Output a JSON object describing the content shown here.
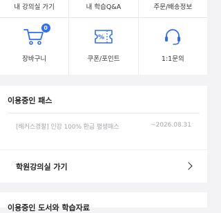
{
  "top_menu": [
    {
      "label": "내 강의실 가기"
    },
    {
      "label": "내 학습Q&A"
    },
    {
      "label": "주문/배송정보"
    }
  ],
  "icon_menu": [
    {
      "label": "장바구니",
      "icon": "cart-icon",
      "badge": "0"
    },
    {
      "label": "쿠폰/포인트",
      "icon": "coupon-icon"
    },
    {
      "label": "1:1문의",
      "icon": "headset-icon"
    }
  ],
  "pass_section": {
    "title": "이용중인 패스",
    "pass_name": "[해커스경찰] 인강 100% 환급 평생패스",
    "pass_date": "~2026.08.31"
  },
  "academy_link": {
    "label": "학원강의실 가기"
  },
  "bottom_section": {
    "title": "이용중인 도서와 학습자료"
  },
  "colors": {
    "accent": "#2f6df6",
    "background": "#f3f3f5"
  }
}
